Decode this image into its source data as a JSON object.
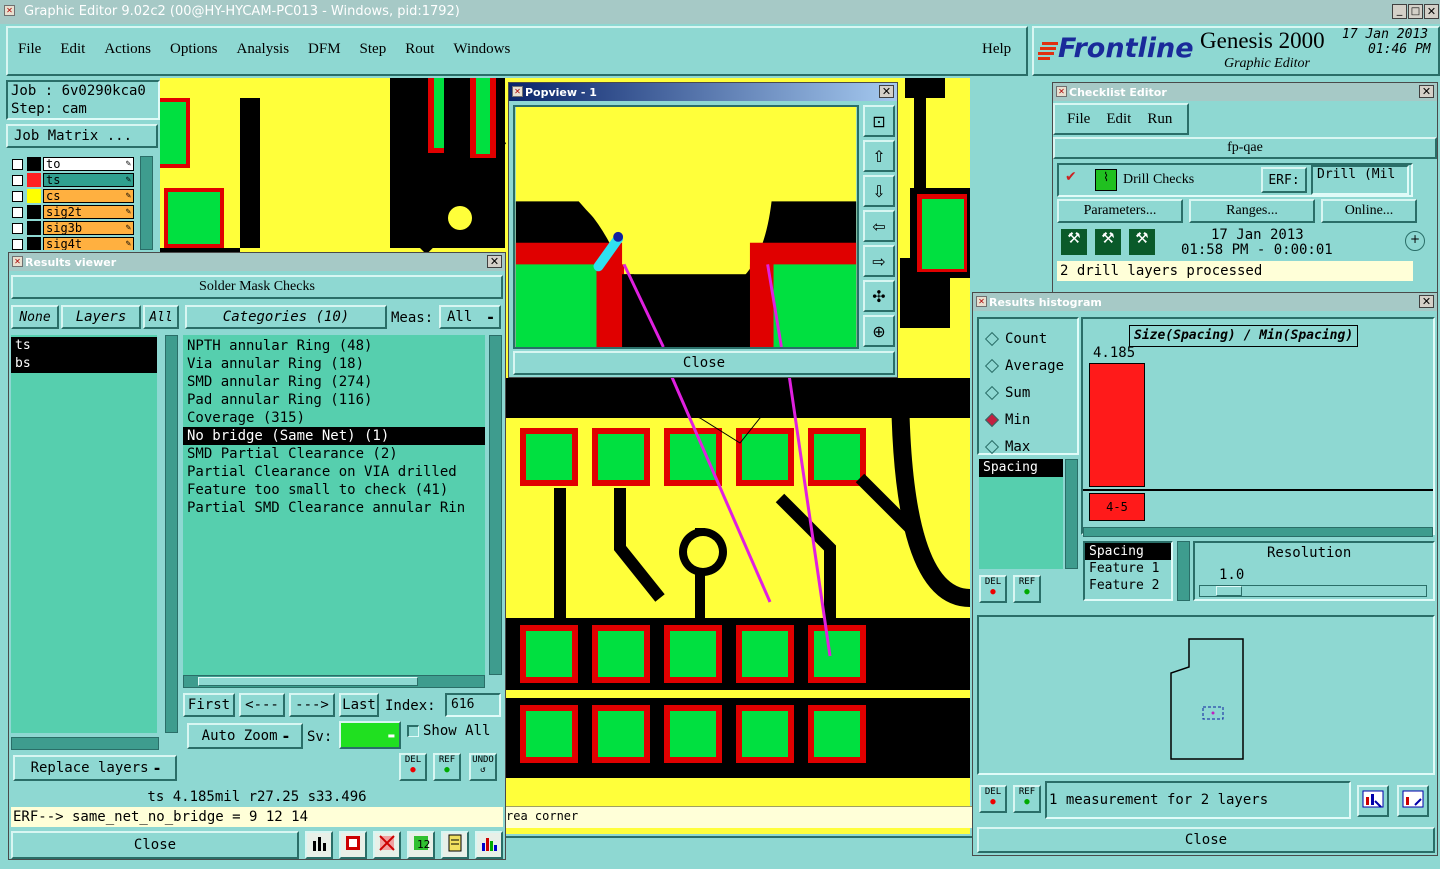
{
  "app": {
    "title": "Graphic Editor 9.02c2 (00@HY-HYCAM-PC013 - Windows, pid:1792)",
    "menu": [
      "File",
      "Edit",
      "Actions",
      "Options",
      "Analysis",
      "DFM",
      "Step",
      "Rout",
      "Windows"
    ],
    "help": "Help",
    "brand": "Frontline",
    "product": "Genesis 2000",
    "subtitle": "Graphic Editor",
    "date": "17 Jan 2013",
    "time": "01:46 PM"
  },
  "job": {
    "job_line": "Job : 6v0290kca0",
    "step_line": "Step: cam",
    "matrix_button": "Job Matrix ...",
    "layers": [
      {
        "name": "to",
        "color": "#000000"
      },
      {
        "name": "ts",
        "color": "#ff2020"
      },
      {
        "name": "cs",
        "color": "#ffff00"
      },
      {
        "name": "sig2t",
        "color": "#000000"
      },
      {
        "name": "sig3b",
        "color": "#000000"
      },
      {
        "name": "sig4t",
        "color": "#000000"
      }
    ]
  },
  "results_viewer": {
    "title": "Results viewer",
    "header": "Solder Mask Checks",
    "none_btn": "None",
    "layers_btn": "Layers",
    "all_btn": "All",
    "categories_btn": "Categories (10)",
    "meas_label": "Meas:",
    "meas_value": "All",
    "layer_items": [
      "ts",
      "bs"
    ],
    "categories": [
      "NPTH annular Ring (48)",
      "Via annular Ring (18)",
      "SMD annular Ring (274)",
      "Pad annular Ring (116)",
      "Coverage (315)",
      "No bridge (Same Net) (1)",
      "SMD Partial Clearance (2)",
      "Partial Clearance on VIA drilled",
      "Feature too small to check (41)",
      "Partial SMD Clearance annular Rin"
    ],
    "first": "First",
    "prev": "<---",
    "next": "--->",
    "last": "Last",
    "index_label": "Index:",
    "index_value": "616",
    "auto_zoom": "Auto Zoom",
    "sv_label": "Sv:",
    "show_all": "Show All",
    "replace_layers": "Replace layers",
    "del": "DEL",
    "ref": "REF",
    "undo": "UNDO",
    "status": "ts 4.185mil   r27.25   s33.496",
    "erf": "ERF--> same_net_no_bridge = 9 12 14",
    "close": "Close"
  },
  "popview": {
    "title": "Popview - 1",
    "close": "Close"
  },
  "canvas": {
    "status_text": "rea corner"
  },
  "checklist": {
    "title": "Checklist Editor",
    "menu": [
      "File",
      "Edit",
      "Run"
    ],
    "name": "fp-qae",
    "check_name": "Drill Checks",
    "erf_label": "ERF:",
    "erf_value": "Drill (Mil",
    "parameters": "Parameters...",
    "ranges": "Ranges...",
    "online": "Online...",
    "run_date": "17 Jan 2013",
    "run_time": "01:58 PM - 0:00:01",
    "message": "2 drill layers processed"
  },
  "histogram": {
    "title": "Results histogram",
    "modes": [
      "Count",
      "Average",
      "Sum",
      "Min",
      "Max"
    ],
    "selected_mode": "Min",
    "list_item": "Spacing",
    "chart_title": "Size(Spacing) / Min(Spacing)",
    "bar_value": "4.185",
    "bar_range": "4-5",
    "sort_items": [
      "Spacing",
      "Feature 1",
      "Feature 2"
    ],
    "resolution_label": "Resolution",
    "resolution_value": "1.0",
    "del": "DEL",
    "ref": "REF",
    "measure_text": "1 measurement for 2 layers",
    "close": "Close"
  }
}
